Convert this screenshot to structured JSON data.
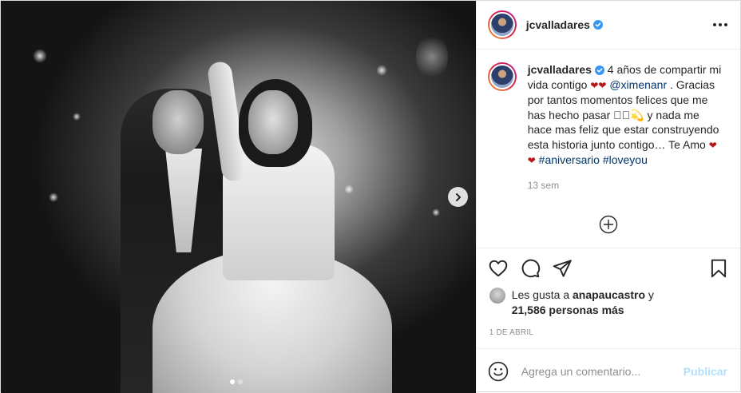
{
  "post": {
    "username": "jcvalladares",
    "verified": true,
    "caption": {
      "part1": " 4 años de compartir mi vida contigo ",
      "hearts1": "❤❤",
      "mention": "@ximenanr",
      "part2": " . Gracias por tantos momentos felices que me has hecho pasar ",
      "emoji_note": "🏻🏻💫",
      "part3": " y nada me hace mas feliz que estar construyendo esta historia junto contigo… Te Amo ",
      "hearts2": "❤❤",
      "hashtag1": "#aniversario",
      "hashtag2": "#loveyou"
    },
    "time_ago": "13 sem",
    "likes": {
      "prefix": "Les gusta a ",
      "user": "anapaucastro",
      "connector": " y",
      "count": "21,586 personas más"
    },
    "date": "1 DE ABRIL",
    "comment_placeholder": "Agrega un comentario...",
    "publish_label": "Publicar",
    "carousel": {
      "slides": 2,
      "active": 1
    }
  },
  "colors": {
    "verified": "#3897f0",
    "link": "#00376b",
    "heart": "#b51818",
    "muted": "#8e8e8e",
    "publish_disabled": "#b2dffc"
  },
  "icons": {
    "more": "more-options-icon",
    "next": "chevron-right-icon",
    "load_more": "plus-circle-icon",
    "like": "heart-icon",
    "comment": "comment-icon",
    "share": "share-icon",
    "save": "bookmark-icon",
    "emoji": "emoji-icon"
  }
}
